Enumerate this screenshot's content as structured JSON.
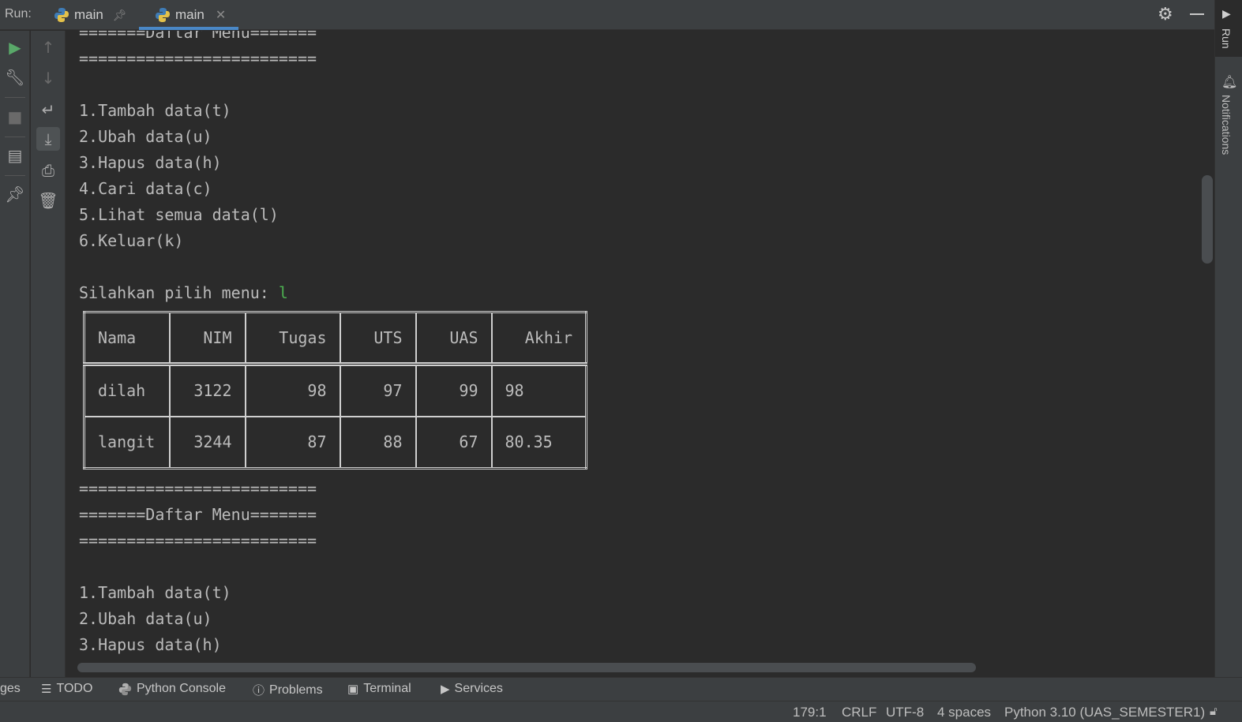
{
  "run_header": {
    "label": "Run:",
    "tabs": [
      {
        "name": "main",
        "pinned": true
      },
      {
        "name": "main",
        "closable": true
      }
    ]
  },
  "right_strip": {
    "run_label": "Run",
    "notifications_label": "Notifications"
  },
  "console": {
    "lines_before": [
      "=======Daftar Menu=======",
      "=========================",
      "",
      "1.Tambah data(t)",
      "2.Ubah data(u)",
      "3.Hapus data(h)",
      "4.Cari data(c)",
      "5.Lihat semua data(l)",
      "6.Keluar(k)",
      ""
    ],
    "prompt": "Silahkan pilih menu: ",
    "input": "l",
    "table": {
      "headers": [
        "Nama",
        "NIM",
        "Tugas",
        "UTS",
        "UAS",
        "Akhir"
      ],
      "rows": [
        [
          "dilah",
          "3122",
          "98",
          "97",
          "99",
          "98"
        ],
        [
          "langit",
          "3244",
          "87",
          "88",
          "67",
          "80.35"
        ]
      ]
    },
    "lines_after": [
      "=========================",
      "=======Daftar Menu=======",
      "=========================",
      "",
      "1.Tambah data(t)",
      "2.Ubah data(u)",
      "3.Hapus data(h)"
    ]
  },
  "bottom_tabs": {
    "partial": "ges",
    "todo": "TODO",
    "python_console": "Python Console",
    "problems": "Problems",
    "terminal": "Terminal",
    "services": "Services"
  },
  "status_bar": {
    "position": "179:1",
    "line_sep": "CRLF",
    "encoding": "UTF-8",
    "indent": "4 spaces",
    "interpreter": "Python 3.10 (UAS_SEMESTER1)"
  }
}
